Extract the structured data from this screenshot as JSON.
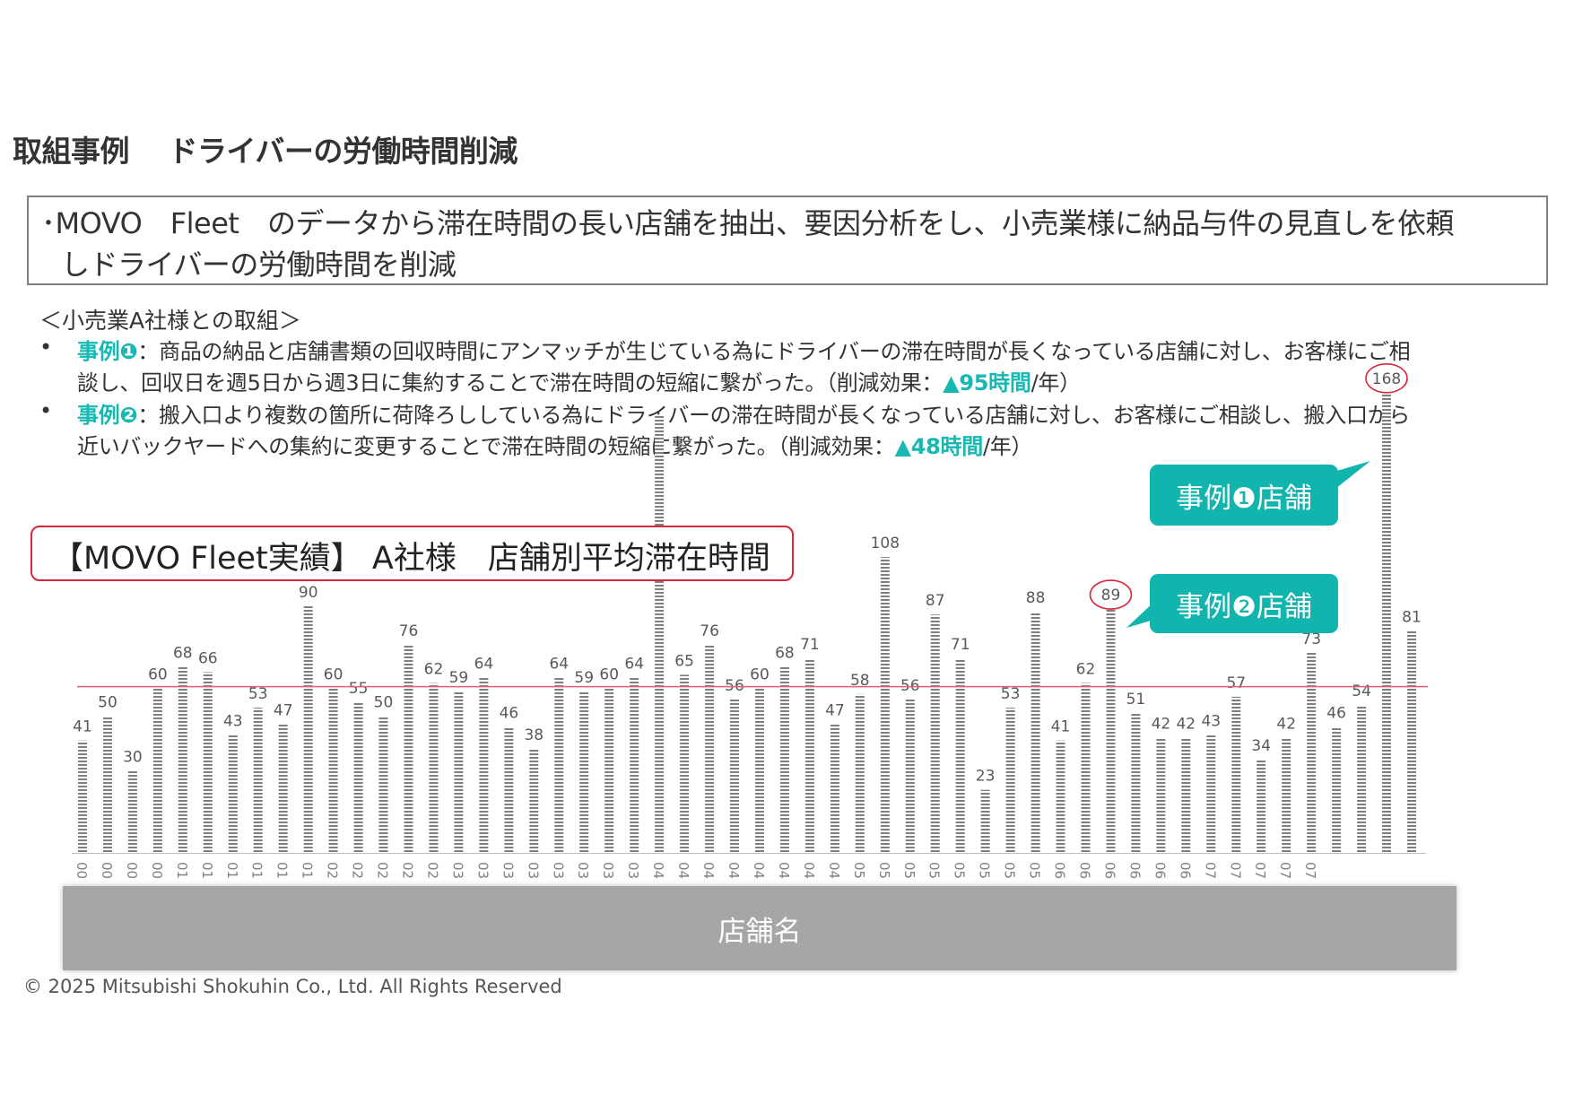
{
  "title": "取組事例　 ドライバーの労働時間削減",
  "summary": {
    "line1": "･MOVO　Fleet　のデータから滞在時間の長い店舗を抽出、要因分析をし、小売業様に納品与件の見直しを依頼",
    "line2": "しドライバーの労働時間を削減"
  },
  "section_heading": "＜小売業A社様との取組＞",
  "bullet_symbol": "•",
  "case1": {
    "label": "事例❶",
    "text_line1": "：商品の納品と店舗書類の回収時間にアンマッチが生じている為にドライバーの滞在時間が長くなっている店舗に対し、お客様にご相",
    "text_line2_pre": "談し、回収日を週5日から週3日に集約することで滞在時間の短縮に繋がった。（削減効果：",
    "effect": "▲95時間",
    "suffix": "/年）"
  },
  "case2": {
    "label": "事例❷",
    "text_line1": "：搬入口より複数の箇所に荷降ろししている為にドライバーの滞在時間が長くなっている店舗に対し、お客様にご相談し、搬入口から",
    "text_line2_pre": "近いバックヤードへの集約に変更することで滞在時間の短縮に繋がった。（削減効果：",
    "effect": "▲48時間",
    "suffix": "/年）"
  },
  "chart_title": "【MOVO Fleet実績】 A社様　店舗別平均滞在時間",
  "callouts": {
    "case1_store": "事例❶店舗",
    "case2_store": "事例❷店舗"
  },
  "x_axis_title": "店舗名",
  "copyright": "© 2025 Mitsubishi Shokuhin Co., Ltd. All Rights Reserved",
  "colors": {
    "bar": "#7f7f7f",
    "average_line": "#e06070",
    "highlight_circle": "#d9263b",
    "callout": "#11b5ae",
    "effect_text": "#16b8b1"
  },
  "chart_data": {
    "type": "bar",
    "title": "【MOVO Fleet実績】 A社様　店舗別平均滞在時間",
    "xlabel": "店舗名",
    "ylabel": "",
    "categories": [
      "00",
      "00",
      "00",
      "00",
      "01",
      "01",
      "01",
      "01",
      "01",
      "01",
      "02",
      "02",
      "02",
      "02",
      "02",
      "03",
      "03",
      "03",
      "03",
      "03",
      "03",
      "03",
      "03",
      "04",
      "04",
      "04",
      "04",
      "04",
      "04",
      "04",
      "04",
      "05",
      "05",
      "05",
      "05",
      "05",
      "05",
      "05",
      "05",
      "06",
      "06",
      "06",
      "06",
      "06",
      "06",
      "07",
      "07",
      "07",
      "07",
      "07"
    ],
    "values": [
      41,
      50,
      30,
      60,
      68,
      66,
      43,
      53,
      47,
      90,
      60,
      55,
      50,
      76,
      62,
      59,
      64,
      46,
      38,
      64,
      59,
      60,
      64,
      null,
      65,
      76,
      56,
      60,
      68,
      71,
      47,
      58,
      108,
      56,
      87,
      71,
      23,
      53,
      88,
      41,
      62,
      89,
      51,
      42,
      42,
      43,
      57,
      34,
      42,
      73,
      46,
      54,
      168,
      81
    ],
    "value_labels_shown": [
      true,
      true,
      true,
      true,
      true,
      true,
      true,
      true,
      true,
      true,
      true,
      true,
      true,
      true,
      true,
      true,
      true,
      true,
      true,
      true,
      true,
      true,
      true,
      false,
      true,
      true,
      true,
      true,
      true,
      true,
      true,
      true,
      true,
      true,
      true,
      true,
      true,
      true,
      true,
      true,
      true,
      true,
      true,
      true,
      true,
      true,
      true,
      true,
      true,
      true,
      true,
      true,
      true,
      true
    ],
    "highlighted_values": [
      89,
      168
    ],
    "average_line": true,
    "grid": false
  }
}
